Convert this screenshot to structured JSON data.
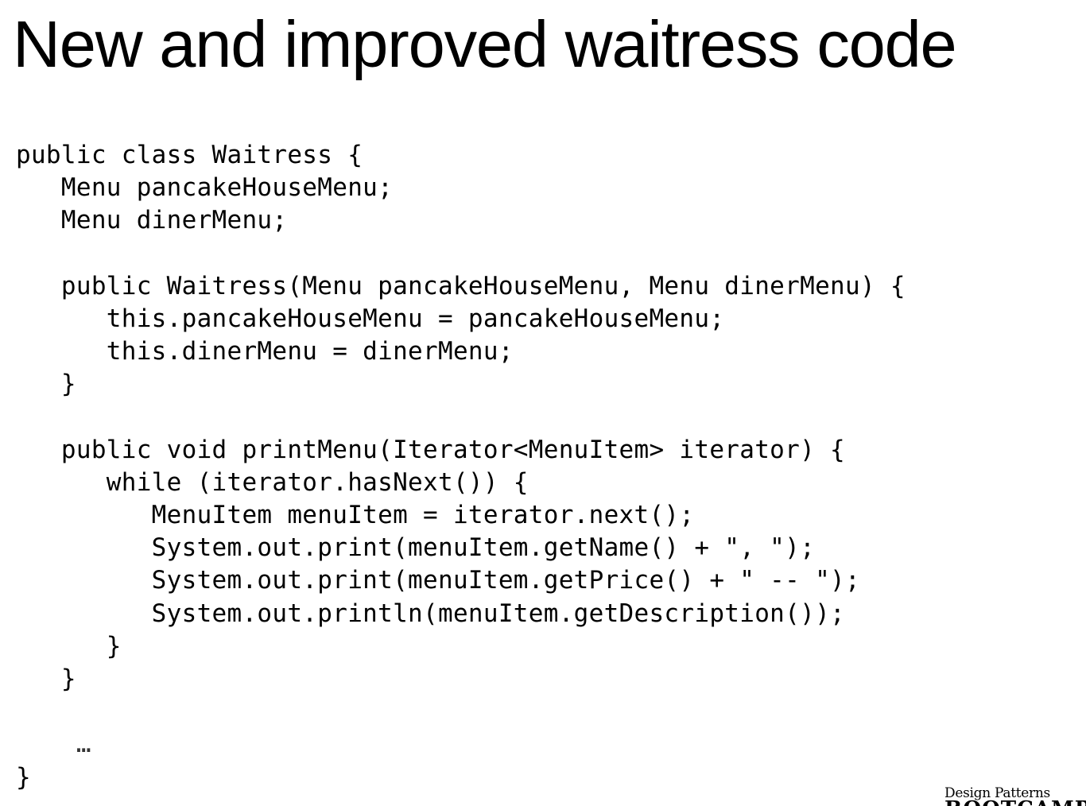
{
  "slide": {
    "title": "New and improved waitress code"
  },
  "code": {
    "lines": [
      "public class Waitress {",
      "   Menu pancakeHouseMenu;",
      "   Menu dinerMenu;",
      "",
      "   public Waitress(Menu pancakeHouseMenu, Menu dinerMenu) {",
      "      this.pancakeHouseMenu = pancakeHouseMenu;",
      "      this.dinerMenu = dinerMenu;",
      "   }",
      "",
      "   public void printMenu(Iterator<MenuItem> iterator) {",
      "      while (iterator.hasNext()) {",
      "         MenuItem menuItem = iterator.next();",
      "         System.out.print(menuItem.getName() + \", \");",
      "         System.out.print(menuItem.getPrice() + \" -- \");",
      "         System.out.println(menuItem.getDescription());",
      "      }",
      "   }",
      "",
      "    …",
      "}"
    ]
  },
  "logo": {
    "line1": "Design Patterns",
    "line2": "BOOTCAMP"
  }
}
